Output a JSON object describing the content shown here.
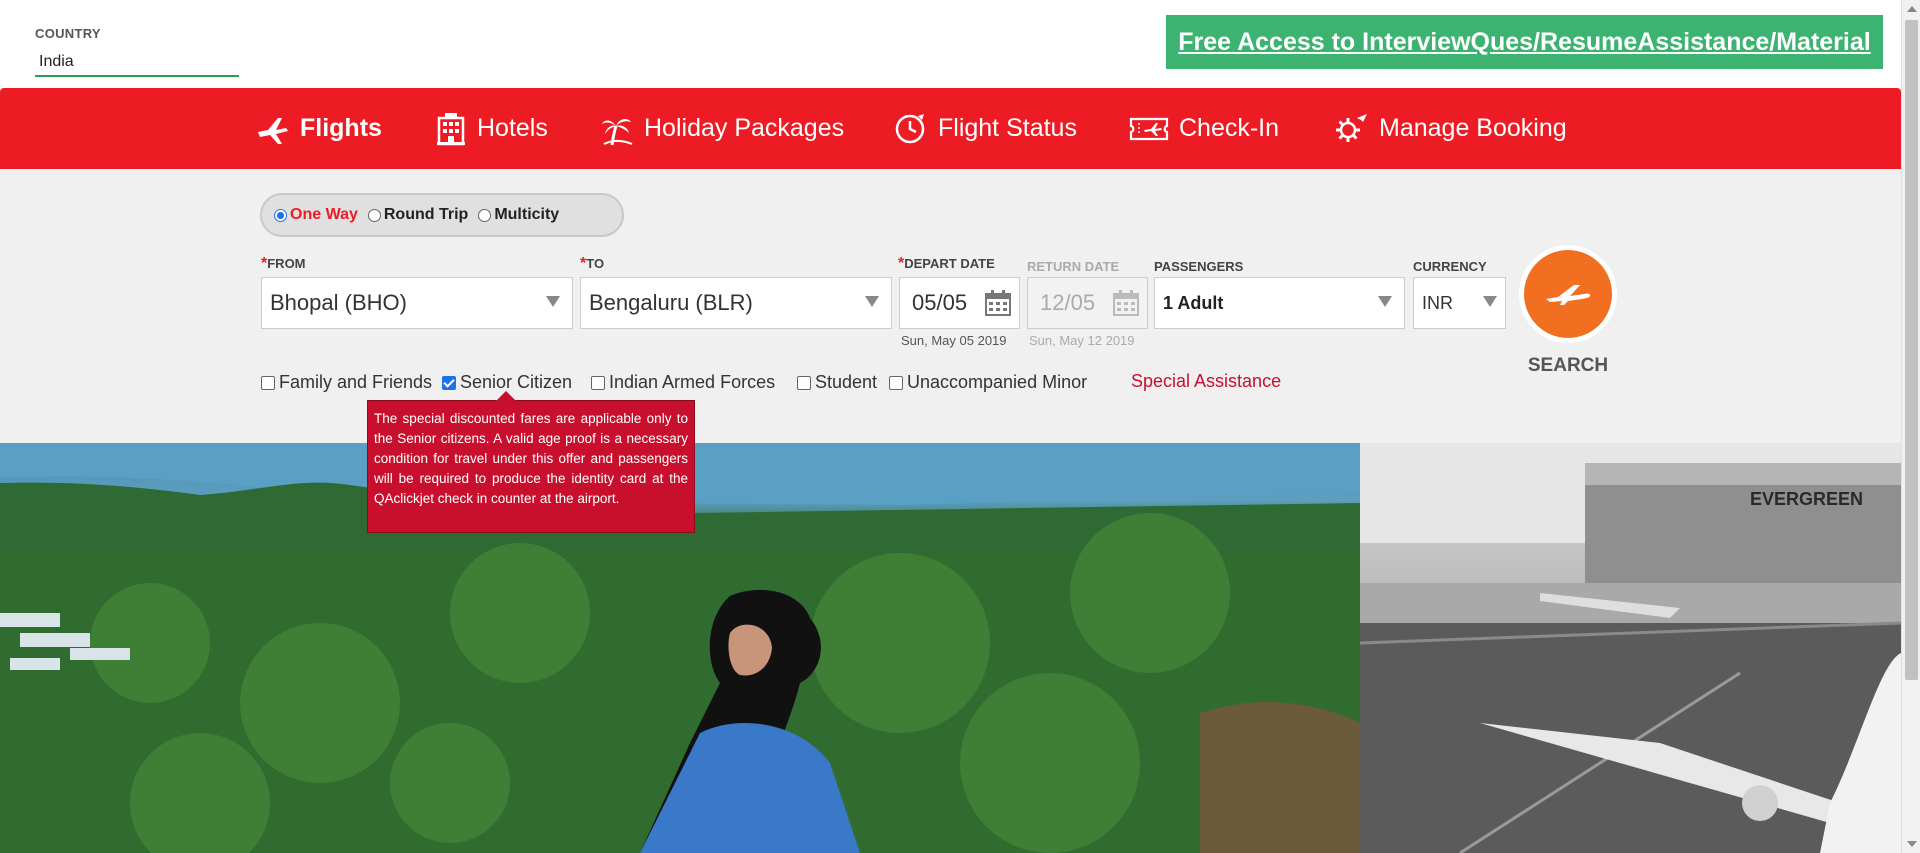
{
  "country": {
    "label": "COUNTRY",
    "value": "India"
  },
  "promo": {
    "text": "Free Access to InterviewQues/ResumeAssistance/Material"
  },
  "nav": {
    "items": [
      {
        "label": "Flights",
        "icon": "plane-icon",
        "active": true
      },
      {
        "label": "Hotels",
        "icon": "hotel-icon"
      },
      {
        "label": "Holiday Packages",
        "icon": "palm-tree-icon"
      },
      {
        "label": "Flight Status",
        "icon": "clock-plane-icon"
      },
      {
        "label": "Check-In",
        "icon": "ticket-icon"
      },
      {
        "label": "Manage Booking",
        "icon": "gear-plane-icon"
      }
    ]
  },
  "trip_type": {
    "options": [
      "One Way",
      "Round Trip",
      "Multicity"
    ],
    "selected": "One Way"
  },
  "from": {
    "label": "FROM",
    "value": "Bhopal (BHO)"
  },
  "to": {
    "label": "TO",
    "value": "Bengaluru (BLR)"
  },
  "depart": {
    "label": "DEPART DATE",
    "value": "05/05",
    "full": "Sun, May 05 2019"
  },
  "return": {
    "label": "RETURN DATE",
    "value": "12/05",
    "full": "Sun, May 12 2019",
    "disabled": true
  },
  "passengers": {
    "label": "PASSENGERS",
    "value": "1 Adult"
  },
  "currency": {
    "label": "CURRENCY",
    "value": "INR"
  },
  "search": {
    "label": "SEARCH"
  },
  "discounts": [
    {
      "label": "Family and Friends",
      "checked": false
    },
    {
      "label": "Senior Citizen",
      "checked": true
    },
    {
      "label": "Indian Armed Forces",
      "checked": false
    },
    {
      "label": "Student",
      "checked": false
    },
    {
      "label": "Unaccompanied Minor",
      "checked": false
    }
  ],
  "special_assistance": "Special Assistance",
  "tooltip": {
    "text": "The special discounted fares are applicable only to the Senior citizens. A valid age proof is a necessary condition for travel under this offer and passengers will be required to produce the identity card at the QAclickjet check in counter at the airport."
  },
  "hero": {
    "right_sign": "EVERGREEN"
  },
  "colors": {
    "brand_red": "#ed1b24",
    "promo_green": "#3cb371",
    "search_orange": "#f26f21",
    "tooltip_red": "#c8102e"
  }
}
